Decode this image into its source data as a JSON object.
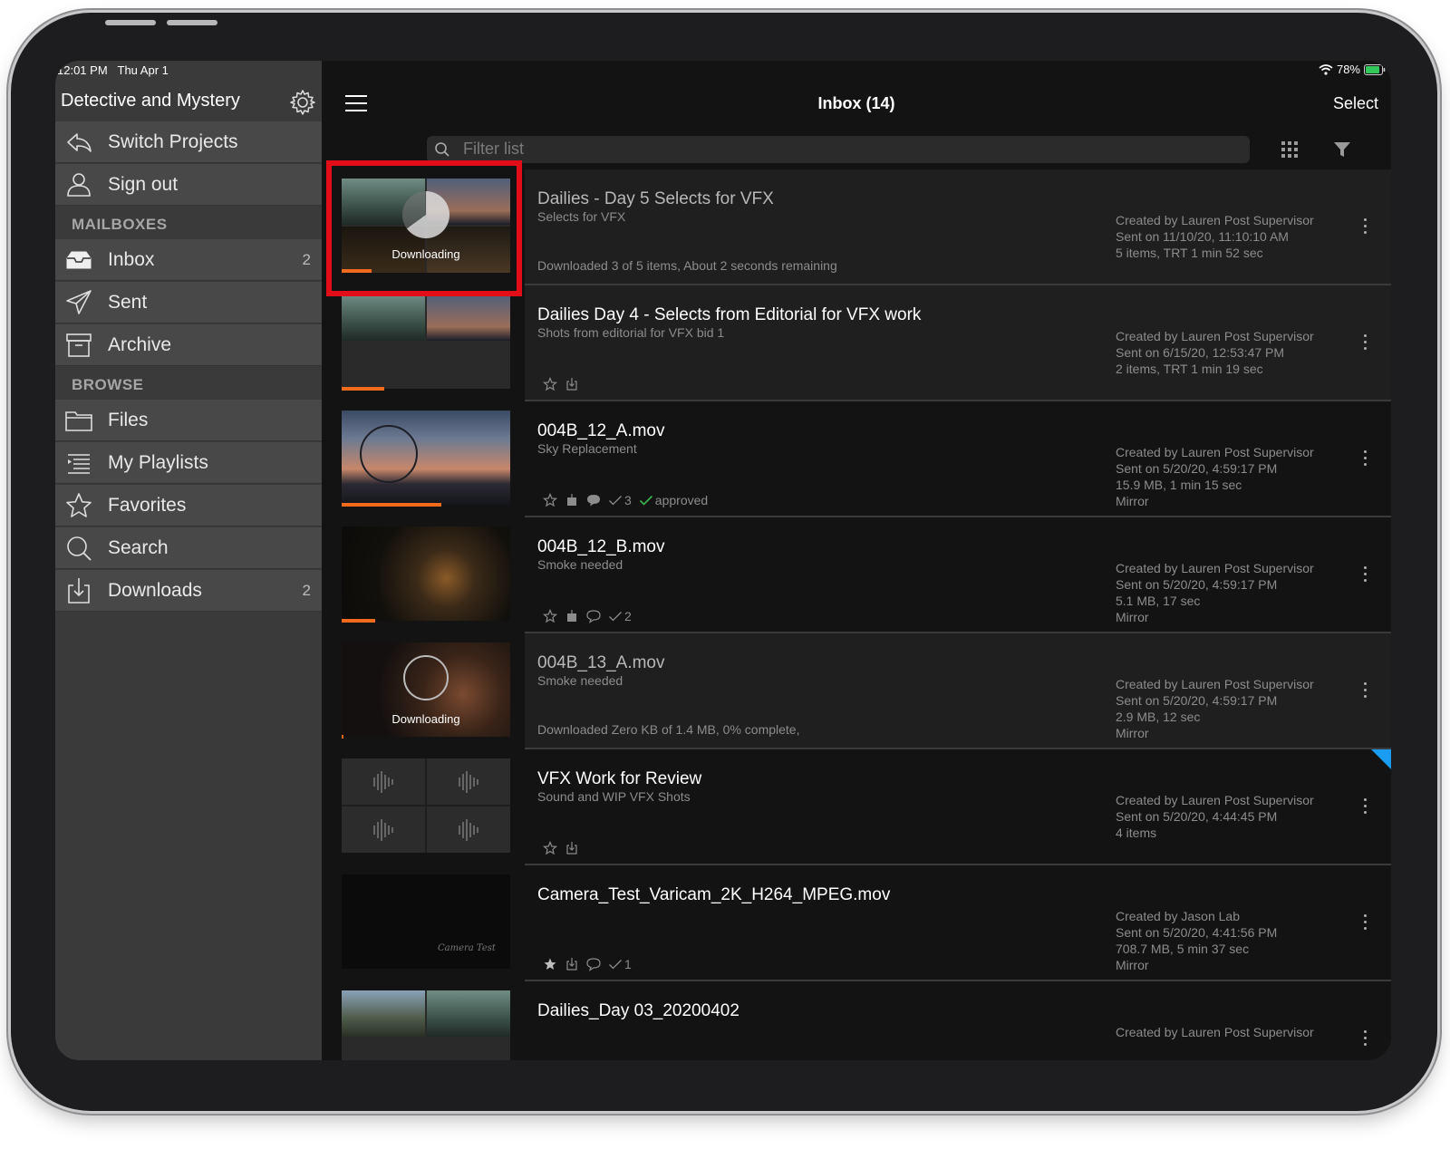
{
  "status_bar": {
    "time": "12:01 PM",
    "date": "Thu Apr 1",
    "battery": "78%"
  },
  "sidebar": {
    "title": "Detective and Mystery",
    "top_items": [
      {
        "label": "Switch Projects",
        "icon": "arrow-back-icon"
      },
      {
        "label": "Sign out",
        "icon": "person-icon"
      }
    ],
    "mailboxes_label": "MAILBOXES",
    "mailboxes": [
      {
        "label": "Inbox",
        "count": "2",
        "icon": "inbox-icon"
      },
      {
        "label": "Sent",
        "count": "",
        "icon": "paper-plane-icon"
      },
      {
        "label": "Archive",
        "count": "",
        "icon": "archive-box-icon"
      }
    ],
    "browse_label": "BROWSE",
    "browse": [
      {
        "label": "Files",
        "count": "",
        "icon": "folder-icon"
      },
      {
        "label": "My Playlists",
        "count": "",
        "icon": "playlist-icon"
      },
      {
        "label": "Favorites",
        "count": "",
        "icon": "star-icon"
      },
      {
        "label": "Search",
        "count": "",
        "icon": "search-icon"
      },
      {
        "label": "Downloads",
        "count": "2",
        "icon": "download-icon"
      }
    ]
  },
  "header": {
    "title": "Inbox (14)",
    "select_label": "Select",
    "filter_placeholder": "Filter list"
  },
  "accent": {
    "progress": "#f26a1b",
    "highlight": "#e20d16",
    "approved": "#3cb54a",
    "unread_flag": "#1a9cf2"
  },
  "rows": [
    {
      "title": "Dailies - Day 5 Selects for VFX",
      "subtitle": "Selects for VFX",
      "status": "Downloaded 3 of 5 items, About 2 seconds remaining",
      "meta": [
        "Created by Lauren Post Supervisor",
        "Sent on 11/10/20, 11:10:10 AM",
        "5 items, TRT 1 min 52 sec"
      ],
      "downloading_label": "Downloading",
      "progress": 0.18
    },
    {
      "title": "Dailies Day 4 - Selects from Editorial for VFX work",
      "subtitle": "Shots from editorial for VFX bid 1",
      "meta": [
        "Created by Lauren Post Supervisor",
        "Sent on 6/15/20, 12:53:47 PM",
        "2 items, TRT 1 min 19 sec"
      ],
      "progress": 0.25
    },
    {
      "title": "004B_12_A.mov",
      "subtitle": "Sky Replacement",
      "approvals": "3",
      "approved_label": "approved",
      "meta": [
        "Created by Lauren Post Supervisor",
        "Sent on 5/20/20, 4:59:17 PM",
        "15.9 MB, 1 min 15 sec",
        "Mirror"
      ],
      "progress": 0.59
    },
    {
      "title": "004B_12_B.mov",
      "subtitle": "Smoke needed",
      "approvals": "2",
      "meta": [
        "Created by Lauren Post Supervisor",
        "Sent on 5/20/20, 4:59:17 PM",
        "5.1 MB, 17 sec",
        "Mirror"
      ],
      "progress": 0.2
    },
    {
      "title": "004B_13_A.mov",
      "subtitle": "Smoke needed",
      "status": "Downloaded Zero KB of 1.4 MB, 0% complete,",
      "meta": [
        "Created by Lauren Post Supervisor",
        "Sent on 5/20/20, 4:59:17 PM",
        "2.9 MB, 12 sec",
        "Mirror"
      ],
      "downloading_label": "Downloading",
      "progress": 0.01
    },
    {
      "title": "VFX Work for Review",
      "subtitle": "Sound and WIP VFX Shots",
      "meta": [
        "Created by Lauren Post Supervisor",
        "Sent on 5/20/20, 4:44:45 PM",
        "4 items"
      ]
    },
    {
      "title": "Camera_Test_Varicam_2K_H264_MPEG.mov",
      "subtitle": "",
      "approvals": "1",
      "thumb_text": "Camera Test",
      "meta": [
        "Created by Jason Lab",
        "Sent on 5/20/20, 4:41:56 PM",
        "708.7 MB, 5 min 37 sec",
        "Mirror"
      ]
    },
    {
      "title": "Dailies_Day 03_20200402",
      "meta": [
        "Created by Lauren Post Supervisor"
      ]
    }
  ]
}
